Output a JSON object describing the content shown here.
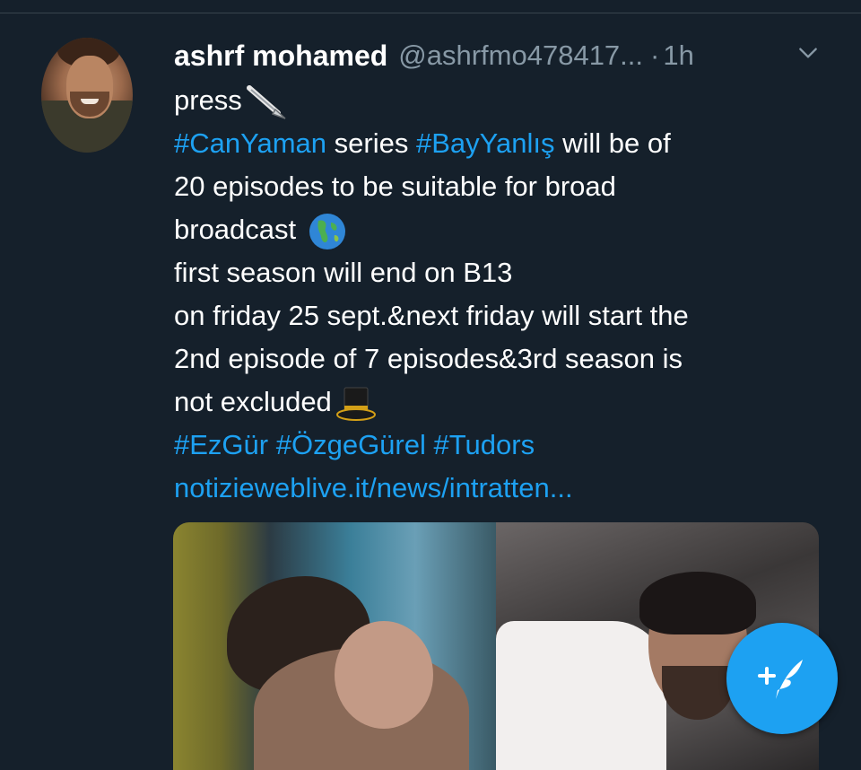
{
  "tweet": {
    "author_name": "ashrf mohamed",
    "handle": "@ashrfmo478417...",
    "separator": "·",
    "time": "1h",
    "lines": [
      {
        "parts": [
          {
            "text": "press",
            "type": "text"
          }
        ],
        "emoji": "pen-nib-icon"
      },
      {
        "parts": [
          {
            "text": "#CanYaman",
            "type": "hashtag"
          },
          {
            "text": " series ",
            "type": "text"
          },
          {
            "text": "#BayYanlış",
            "type": "hashtag"
          },
          {
            "text": " will be of",
            "type": "text"
          }
        ]
      },
      {
        "parts": [
          {
            "text": "20 episodes to be suitable for broad",
            "type": "text"
          }
        ]
      },
      {
        "parts": [
          {
            "text": "broadcast ",
            "type": "text"
          }
        ],
        "emoji": "globe-icon"
      },
      {
        "parts": [
          {
            "text": "first season will end on B13",
            "type": "text"
          }
        ]
      },
      {
        "parts": [
          {
            "text": "on friday 25 sept.&next friday will start the",
            "type": "text"
          }
        ]
      },
      {
        "parts": [
          {
            "text": "2nd episode of 7 episodes&3rd season is",
            "type": "text"
          }
        ]
      },
      {
        "parts": [
          {
            "text": "not excluded",
            "type": "text"
          }
        ],
        "emoji": "top-hat-icon"
      },
      {
        "parts": [
          {
            "text": "#EzGür",
            "type": "hashtag"
          },
          {
            "text": " ",
            "type": "text"
          },
          {
            "text": "#ÖzgeGürel",
            "type": "hashtag"
          },
          {
            "text": " ",
            "type": "text"
          },
          {
            "text": "#Tudors",
            "type": "hashtag"
          }
        ]
      },
      {
        "parts": [
          {
            "text": "notizieweblive.it/news/intratten...",
            "type": "link"
          }
        ]
      }
    ]
  },
  "colors": {
    "background": "#15202b",
    "accent": "#1da1f2",
    "secondary_text": "#8899a6"
  },
  "icons": {
    "more": "chevron-down-icon",
    "compose": "compose-tweet-icon"
  }
}
